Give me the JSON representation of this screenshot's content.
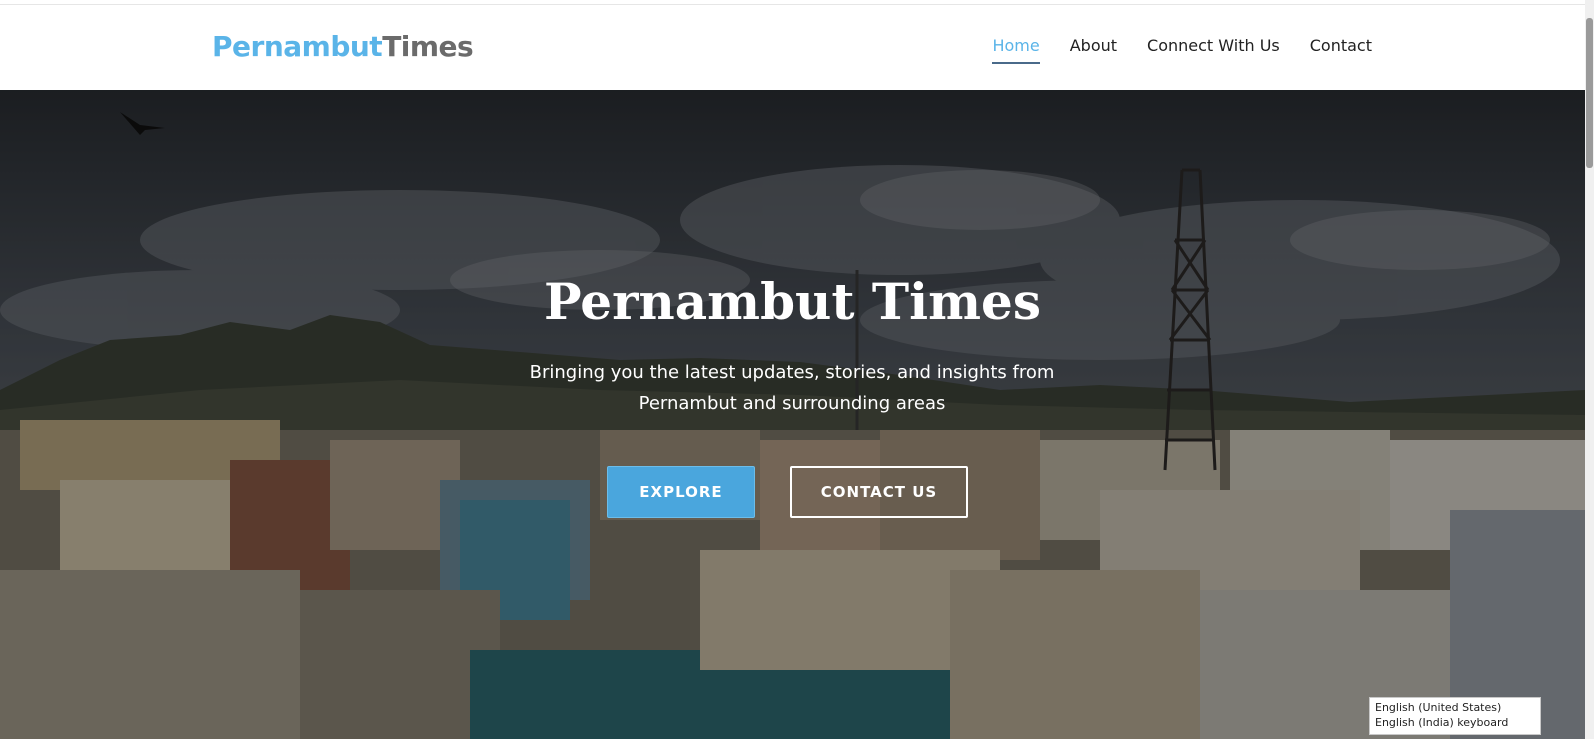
{
  "brand": {
    "part1": "Pernambut",
    "part2": "Times"
  },
  "nav": {
    "items": [
      {
        "label": "Home",
        "active": true
      },
      {
        "label": "About",
        "active": false
      },
      {
        "label": "Connect With Us",
        "active": false
      },
      {
        "label": "Contact",
        "active": false
      }
    ]
  },
  "hero": {
    "title": "Pernambut Times",
    "subtitle_line1": "Bringing you the latest updates, stories, and insights from",
    "subtitle_line2": "Pernambut and surrounding areas",
    "explore_label": "EXPLORE",
    "contact_label": "CONTACT US"
  },
  "ime_popup": {
    "line1": "English (United States)",
    "line2": "English (India) keyboard"
  },
  "colors": {
    "brand_accent": "#5ab4e8",
    "brand_secondary": "#6b6b6b",
    "explore_button": "#4aa6dd",
    "nav_text": "#222222"
  }
}
